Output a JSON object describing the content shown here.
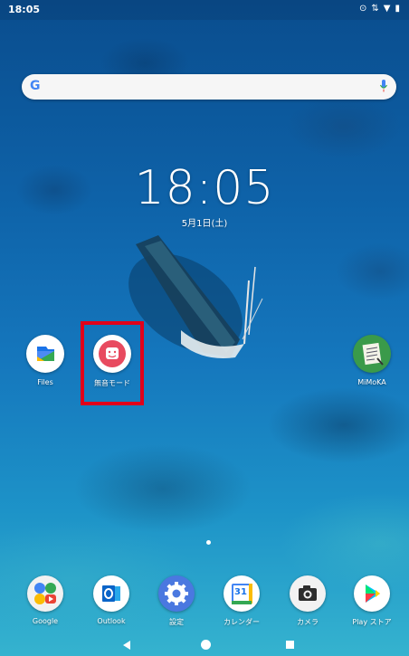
{
  "status_bar": {
    "time": "18:05"
  },
  "search": {
    "placeholder": ""
  },
  "lock": {
    "time": "18:05",
    "date": "5月1日(土)"
  },
  "apps": {
    "files": "Files",
    "silent_mode": "無音モード",
    "mimoka": "MiMoKA"
  },
  "dock": {
    "google": "Google",
    "outlook": "Outlook",
    "settings": "設定",
    "calendar": "カレンダー",
    "calendar_day": "31",
    "camera": "カメラ",
    "play_store": "Play ストア"
  },
  "colors": {
    "highlight": "#e1001a",
    "outlook_blue": "#0a64c8",
    "settings_blue": "#4a78e0"
  }
}
